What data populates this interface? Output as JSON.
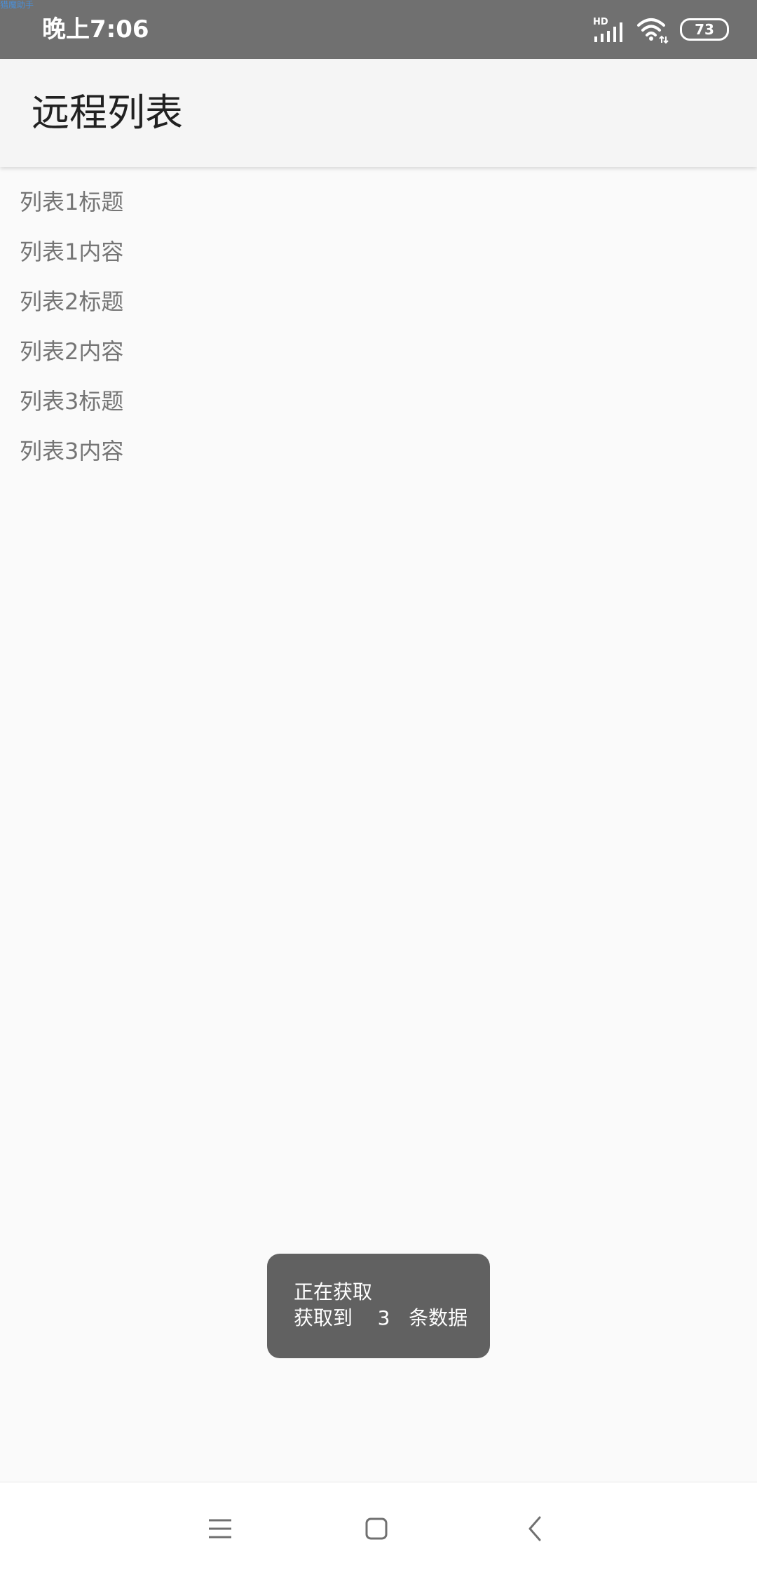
{
  "overlay_tag": "猎魔助手",
  "status_bar": {
    "time": "晚上7:06",
    "network_label": "HD",
    "battery_level": "73",
    "icons": [
      "signal-icon",
      "wifi-icon",
      "battery-icon"
    ]
  },
  "app_bar": {
    "title": "远程列表"
  },
  "list": {
    "items": [
      "列表1标题",
      "列表1内容",
      "列表2标题",
      "列表2内容",
      "列表3标题",
      "列表3内容"
    ]
  },
  "toast": {
    "line1": "正在获取",
    "line2": "获取到    3   条数据"
  },
  "nav_bar": {
    "icons": [
      "menu-icon",
      "home-icon",
      "back-icon"
    ]
  },
  "colors": {
    "status_bar_bg": "#707070",
    "app_bar_bg": "#f5f5f5",
    "page_bg": "#fafafa",
    "list_text": "#757575",
    "toast_bg": "#616161"
  }
}
